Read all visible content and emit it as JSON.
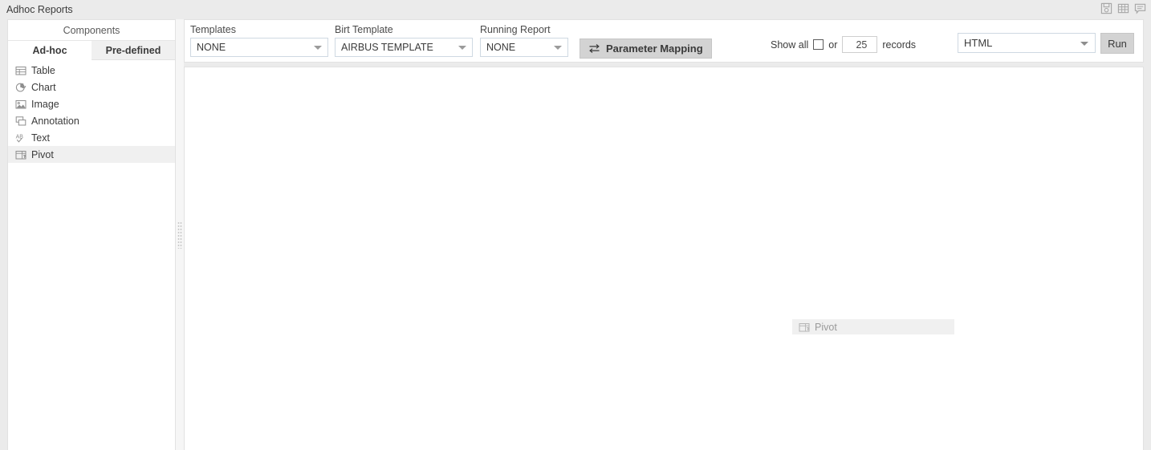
{
  "window": {
    "title": "Adhoc Reports",
    "icons": [
      {
        "name": "save-icon",
        "label": "Save"
      },
      {
        "name": "table-grid-icon",
        "label": "Grid"
      },
      {
        "name": "comment-icon",
        "label": "Comment"
      }
    ]
  },
  "sidebar": {
    "header": "Components",
    "tabs": [
      {
        "label": "Ad-hoc",
        "active": true
      },
      {
        "label": "Pre-defined",
        "active": false
      }
    ],
    "items": [
      {
        "label": "Table",
        "icon": "table-icon",
        "selected": false
      },
      {
        "label": "Chart",
        "icon": "pie-chart-icon",
        "selected": false
      },
      {
        "label": "Image",
        "icon": "image-icon",
        "selected": false
      },
      {
        "label": "Annotation",
        "icon": "annotation-icon",
        "selected": false
      },
      {
        "label": "Text",
        "icon": "text-ab-icon",
        "selected": false
      },
      {
        "label": "Pivot",
        "icon": "pivot-icon",
        "selected": true
      }
    ]
  },
  "toolbar": {
    "templates": {
      "label": "Templates",
      "value": "NONE"
    },
    "birt_template": {
      "label": "Birt Template",
      "value": "AIRBUS TEMPLATE"
    },
    "running_report": {
      "label": "Running Report",
      "value": "NONE"
    },
    "parameter_mapping": {
      "label": "Parameter Mapping",
      "icon": "swap-arrows-icon"
    },
    "show_all": {
      "label": "Show all",
      "checked": false
    },
    "or_label": "or",
    "records_value": "25",
    "records_label": "records",
    "format": {
      "value": "HTML"
    },
    "run": {
      "label": "Run"
    }
  },
  "canvas": {
    "drag_ghost": {
      "label": "Pivot",
      "icon": "pivot-icon"
    }
  },
  "colors": {
    "window_bg": "#ebebeb",
    "panel_bg": "#ffffff",
    "panel_border": "#e2e2e2",
    "selected_row": "#f0f0f0",
    "button_bg": "#d3d3d3",
    "combo_border": "#cfd9e2",
    "text": "#3b3b3b",
    "muted_text": "#9a9a9a"
  }
}
